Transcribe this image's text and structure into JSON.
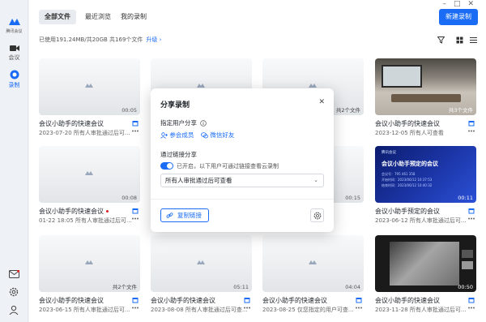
{
  "sidebar": {
    "brand": "腾讯会议",
    "items": [
      {
        "label": "会议"
      },
      {
        "label": "录制"
      }
    ]
  },
  "header": {
    "tabs": [
      {
        "label": "全部文件"
      },
      {
        "label": "最近浏览"
      },
      {
        "label": "我的录制"
      }
    ],
    "new_button": "新建录制"
  },
  "storage": {
    "text": "已使用191.24MB/共20GB  共169个文件",
    "upgrade": "升级 ›"
  },
  "cards": [
    {
      "title": "会议小助手的快速会议",
      "meta": "2023-07-20  所有人审批通过后可...",
      "badge": "00:05"
    },
    {
      "title": "会议小助手的快速会议",
      "meta": "",
      "badge": ""
    },
    {
      "title": "",
      "meta": "",
      "badge": "共2个文件"
    },
    {
      "title": "会议小助手的快速会议",
      "meta": "2023-12-05  所有人可查看",
      "badge": "共3个文件"
    },
    {
      "title": "会议小助手的快速会议",
      "meta": "01-22 18:05  所有人审批通过后可...",
      "badge": "00:08"
    },
    {
      "title": "",
      "meta": "",
      "badge": ""
    },
    {
      "title": "",
      "meta": "",
      "badge": "00:15"
    },
    {
      "title": "会议小助手预定的会议",
      "meta": "2023-06-12  所有人审批通过后可...",
      "badge": "00:11"
    },
    {
      "title": "会议小助手的快速会议",
      "meta": "2023-06-15  所有人审批通过后可...",
      "badge": "共2个文件"
    },
    {
      "title": "会议小助手的快速会议",
      "meta": "2023-08-08  所有人审批通过后可查...",
      "badge": "05:11"
    },
    {
      "title": "会议小助手的快速会议",
      "meta": "2023-08-25  仅您指定的用户可查...",
      "badge": "04:04"
    },
    {
      "title": "会议小助手的快速会议",
      "meta": "2023-11-28  所有人审批通过后可...",
      "badge": "00:50"
    }
  ],
  "blue_thumb": {
    "header": "腾讯会议",
    "title": "会议小助手预定的会议",
    "lines": [
      "会议号：795 461 358",
      "开始时间：2023/06/12 10:37:53",
      "结束时间：2023/06/12 10:40:32"
    ]
  },
  "modal": {
    "title": "分享录制",
    "close": "✕",
    "section1": "指定用户分享",
    "add_member": "参会成员",
    "wechat": "微信好友",
    "section2": "通过链接分享",
    "link_desc": "已开启，以下用户可通过链接查看云录制",
    "select_value": "所有人审批通过后可查看",
    "copy_link": "复制链接"
  },
  "colors": {
    "accent": "#1a6cf5",
    "badge_red": "#e02020"
  }
}
